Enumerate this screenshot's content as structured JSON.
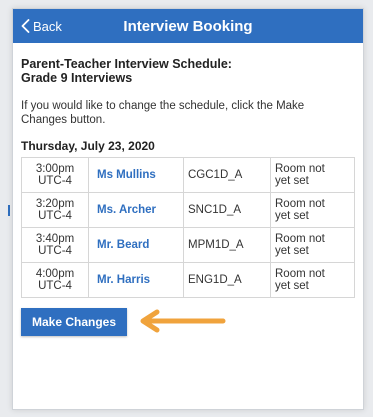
{
  "navbar": {
    "back_label": "Back",
    "title": "Interview Booking",
    "color": "#2f6fc0"
  },
  "main": {
    "heading_line1": "Parent-Teacher Interview Schedule:",
    "heading_line2": "Grade 9 Interviews",
    "instructions_line1": "If you would like to change the schedule, click the Make",
    "instructions_line2": "Changes button.",
    "date": "Thursday, July 23, 2020"
  },
  "schedule": [
    {
      "time": "3:00pm",
      "tz": "UTC-4",
      "teacher": "Ms Mullins",
      "course": "CGC1D_A",
      "room1": "Room not",
      "room2": "yet set"
    },
    {
      "time": "3:20pm",
      "tz": "UTC-4",
      "teacher": "Ms. Archer",
      "course": "SNC1D_A",
      "room1": "Room not",
      "room2": "yet set"
    },
    {
      "time": "3:40pm",
      "tz": "UTC-4",
      "teacher": "Mr. Beard",
      "course": "MPM1D_A",
      "room1": "Room not",
      "room2": "yet set"
    },
    {
      "time": "4:00pm",
      "tz": "UTC-4",
      "teacher": "Mr. Harris",
      "course": "ENG1D_A",
      "room1": "Room not",
      "room2": "yet set"
    }
  ],
  "actions": {
    "make_changes_label": "Make Changes",
    "arrow_color": "#f0a33c"
  }
}
